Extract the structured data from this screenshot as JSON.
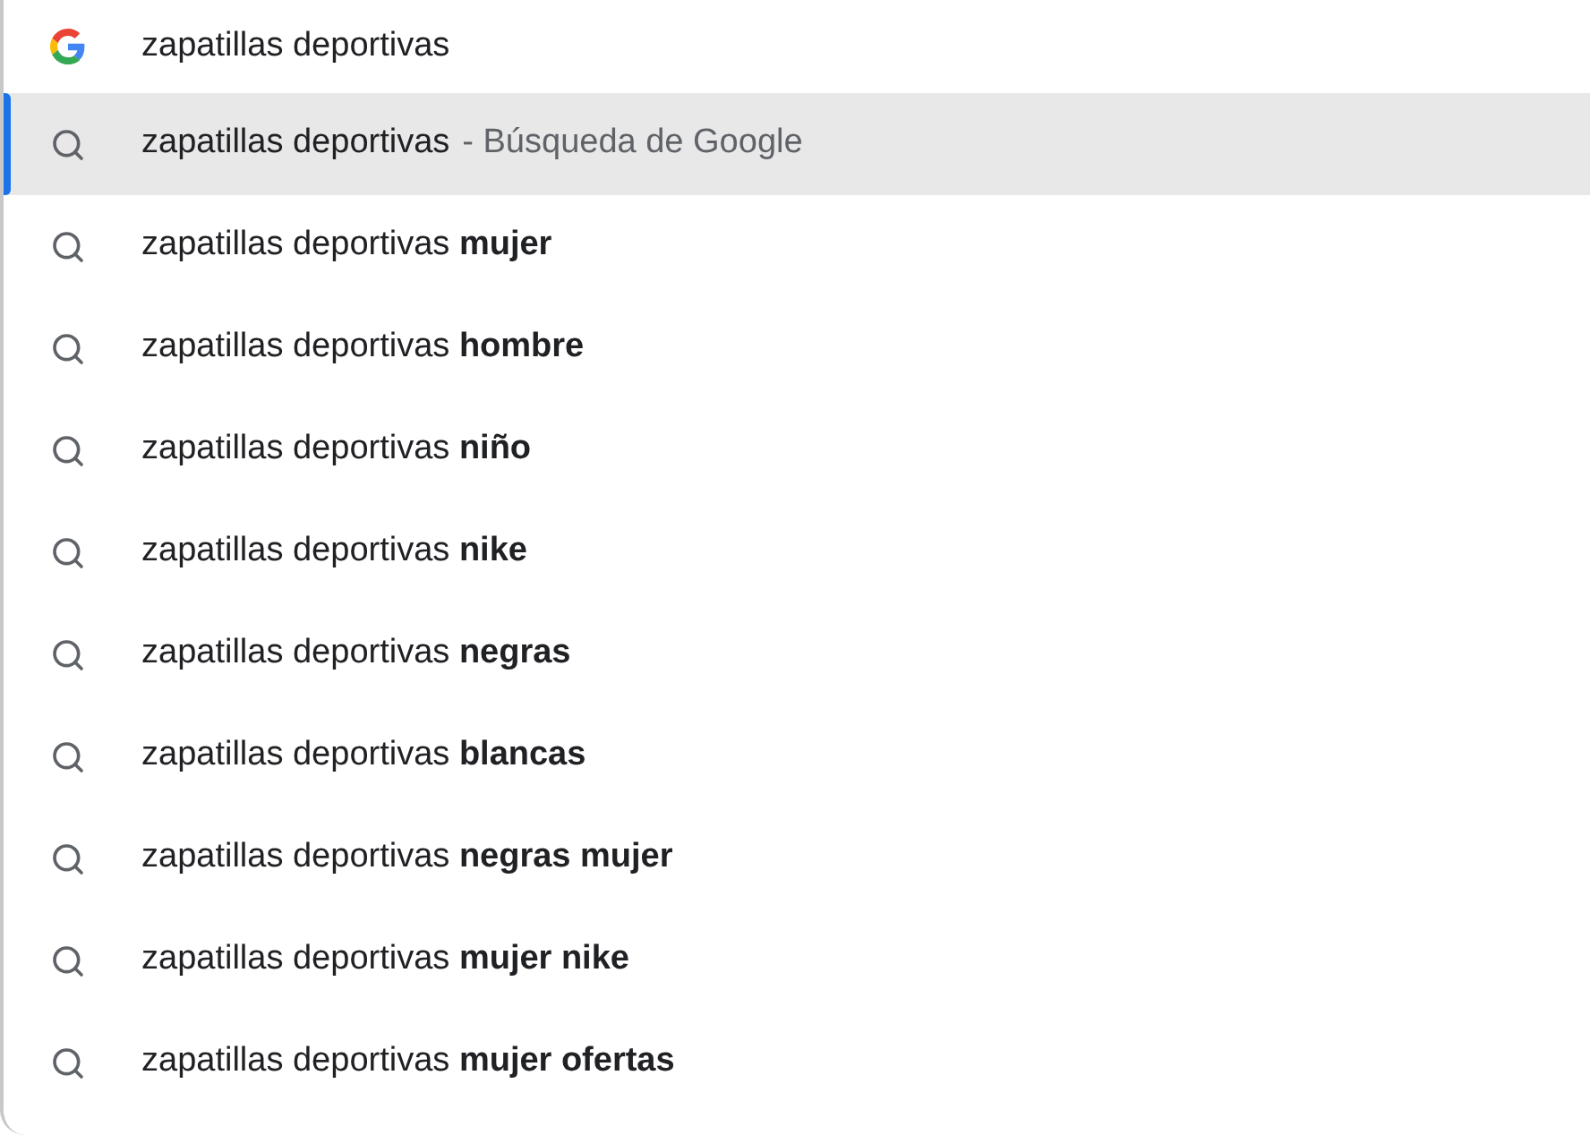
{
  "omnibox": {
    "value": "zapatillas deportivas"
  },
  "suggestions": [
    {
      "text": "zapatillas deportivas",
      "detail": "- Búsqueda de Google",
      "selected": true
    },
    {
      "text": "zapatillas deportivas **mujer**",
      "selected": false
    },
    {
      "text": "zapatillas deportivas **hombre**",
      "selected": false
    },
    {
      "text": "zapatillas deportivas **niño**",
      "selected": false
    },
    {
      "text": "zapatillas deportivas **nike**",
      "selected": false
    },
    {
      "text": "zapatillas deportivas **negras**",
      "selected": false
    },
    {
      "text": "zapatillas deportivas **blancas**",
      "selected": false
    },
    {
      "text": "zapatillas deportivas **negras mujer**",
      "selected": false
    },
    {
      "text": "zapatillas deportivas **mujer nike**",
      "selected": false
    },
    {
      "text": "zapatillas deportivas **mujer ofertas**",
      "selected": false
    }
  ]
}
